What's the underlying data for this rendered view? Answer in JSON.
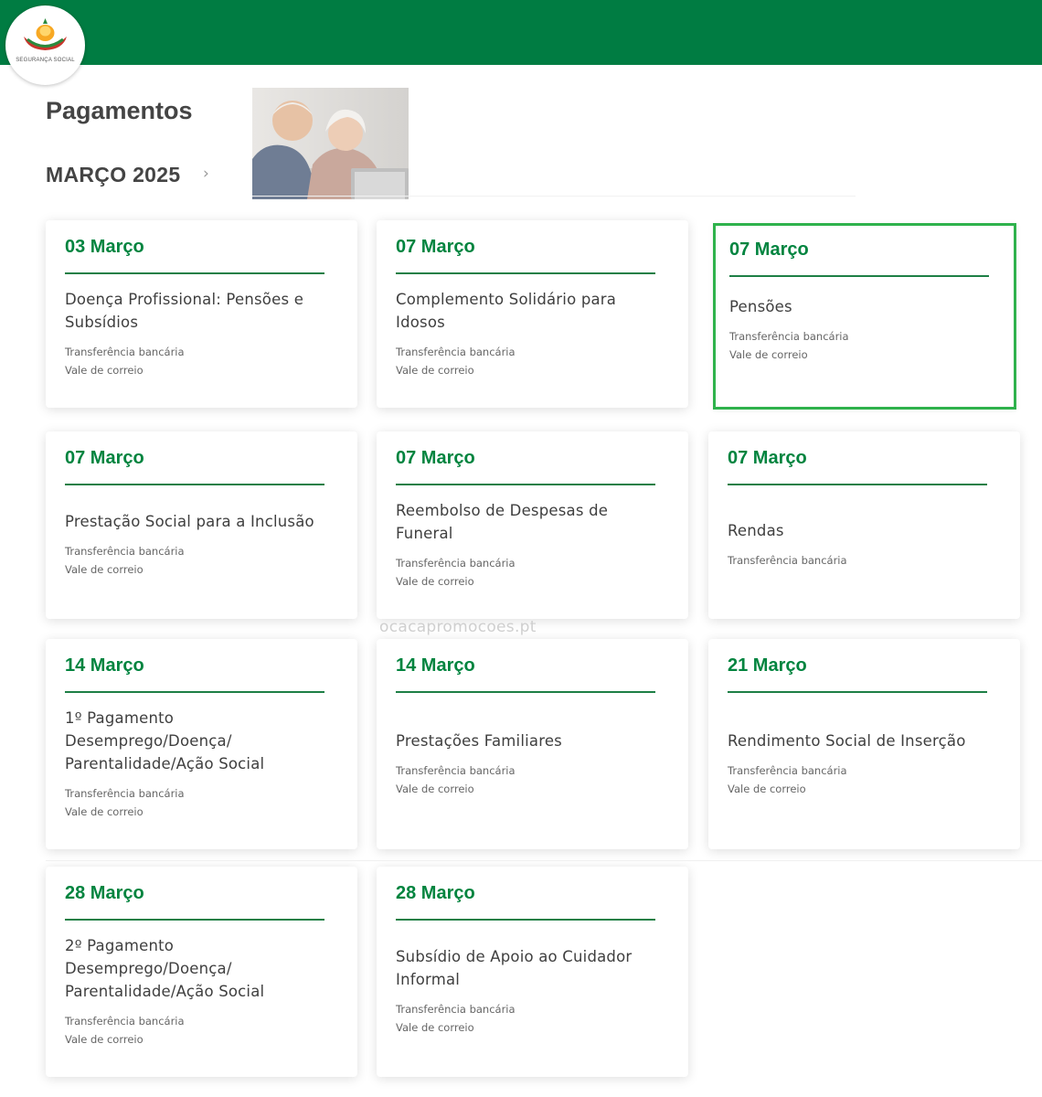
{
  "header": {
    "logo_text": "SEGURANÇA SOCIAL"
  },
  "page": {
    "title": "Pagamentos",
    "month": "MARÇO 2025",
    "next_icon": "chevron-right-icon",
    "photo_alt": "photo-elderly-couple"
  },
  "watermark": "ocacapromocoes.pt",
  "payments": [
    {
      "date": "03 Março",
      "title_lines": [
        "Doença Profissional: Pensões e",
        "Subsídios"
      ],
      "methods": [
        "Transferência bancária",
        "Vale de correio"
      ]
    },
    {
      "date": "07 Março",
      "title_lines": [
        "Complemento Solidário para",
        "Idosos"
      ],
      "methods": [
        "Transferência bancária",
        "Vale de correio"
      ]
    },
    {
      "date": "07 Março",
      "title_lines": [
        "Pensões"
      ],
      "methods": [
        "Transferência bancária",
        "Vale de correio"
      ],
      "selected": true
    },
    {
      "date": "07 Março",
      "title_lines": [
        "Prestação Social para a Inclusão"
      ],
      "methods": [
        "Transferência bancária",
        "Vale de correio"
      ]
    },
    {
      "date": "07 Março",
      "title_lines": [
        "Reembolso de Despesas de",
        "Funeral"
      ],
      "methods": [
        "Transferência bancária",
        "Vale de correio"
      ]
    },
    {
      "date": "07 Março",
      "title_lines": [
        "Rendas"
      ],
      "methods": [
        "Transferência bancária"
      ]
    },
    {
      "date": "14 Março",
      "title_lines": [
        "1º Pagamento",
        "Desemprego/Doença/",
        "Parentalidade/Ação Social"
      ],
      "methods": [
        "Transferência bancária",
        "Vale de correio"
      ]
    },
    {
      "date": "14 Março",
      "title_lines": [
        "Prestações Familiares"
      ],
      "methods": [
        "Transferência bancária",
        "Vale de correio"
      ]
    },
    {
      "date": "21 Março",
      "title_lines": [
        "Rendimento Social de Inserção"
      ],
      "methods": [
        "Transferência bancária",
        "Vale de correio"
      ]
    },
    {
      "date": "28 Março",
      "title_lines": [
        "2º Pagamento",
        "Desemprego/Doença/",
        "Parentalidade/Ação Social"
      ],
      "methods": [
        "Transferência bancária",
        "Vale de correio"
      ]
    },
    {
      "date": "28 Março",
      "title_lines": [
        "Subsídio de Apoio ao Cuidador",
        "Informal"
      ],
      "methods": [
        "Transferência bancária",
        "Vale de correio"
      ]
    }
  ],
  "colors": {
    "brand_green": "#007c42",
    "date_green": "#00843f",
    "selected_border": "#2fb24c"
  }
}
